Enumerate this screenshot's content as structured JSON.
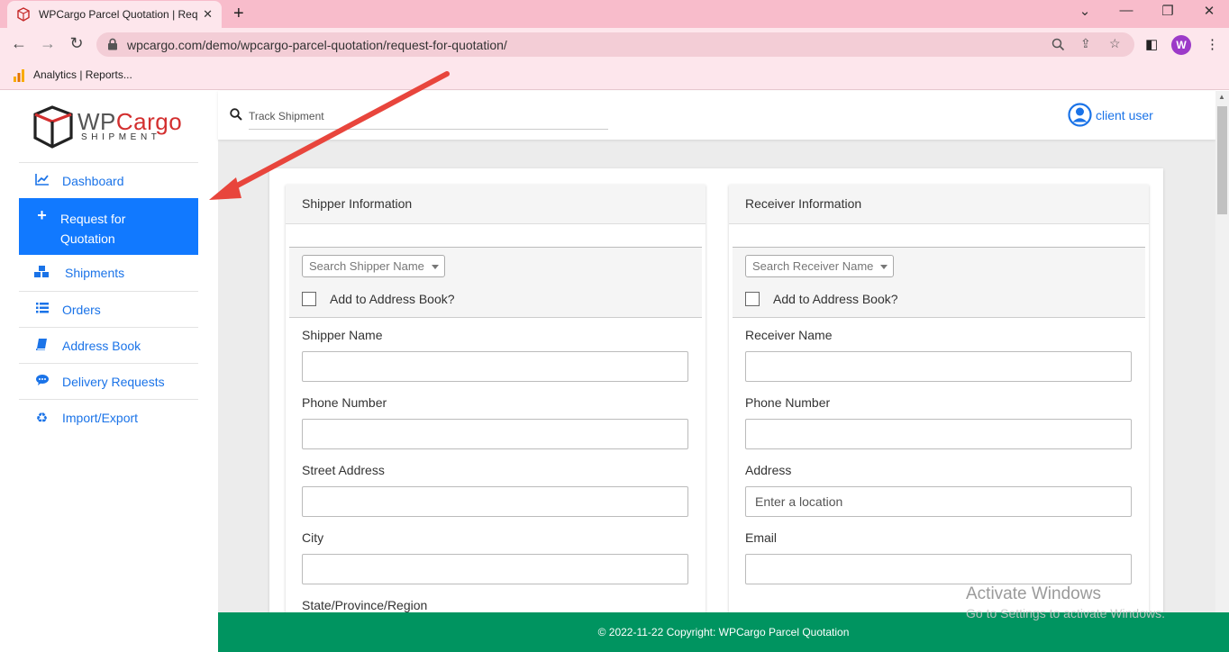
{
  "browser": {
    "tab_title": "WPCargo Parcel Quotation | Requ",
    "url": "wpcargo.com/demo/wpcargo-parcel-quotation/request-for-quotation/",
    "profile_initial": "W",
    "bookmark_label": "Analytics | Reports..."
  },
  "logo": {
    "wp": "WP",
    "cargo": "Cargo",
    "sub": "SHIPMENT"
  },
  "sidebar": {
    "items": [
      {
        "label": "Dashboard",
        "icon": "chart-line-icon"
      },
      {
        "label": "Request for Quotation",
        "icon": "plus-icon",
        "active": true
      },
      {
        "label": "Shipments",
        "icon": "cubes-icon"
      },
      {
        "label": "Orders",
        "icon": "list-icon"
      },
      {
        "label": "Address Book",
        "icon": "book-icon"
      },
      {
        "label": "Delivery Requests",
        "icon": "comment-icon"
      },
      {
        "label": "Import/Export",
        "icon": "recycle-icon"
      }
    ]
  },
  "topbar": {
    "track_placeholder": "Track Shipment",
    "user_label": "client user"
  },
  "shipper": {
    "title": "Shipper Information",
    "search_placeholder": "Search Shipper Name",
    "address_book_label": "Add to Address Book?",
    "fields": [
      {
        "label": "Shipper Name",
        "value": "",
        "placeholder": ""
      },
      {
        "label": "Phone Number",
        "value": "",
        "placeholder": ""
      },
      {
        "label": "Street Address",
        "value": "",
        "placeholder": ""
      },
      {
        "label": "City",
        "value": "",
        "placeholder": ""
      },
      {
        "label": "State/Province/Region"
      }
    ]
  },
  "receiver": {
    "title": "Receiver Information",
    "search_placeholder": "Search Receiver Name",
    "address_book_label": "Add to Address Book?",
    "fields": [
      {
        "label": "Receiver Name",
        "value": "",
        "placeholder": ""
      },
      {
        "label": "Phone Number",
        "value": "",
        "placeholder": ""
      },
      {
        "label": "Address",
        "value": "",
        "placeholder": "Enter a location"
      },
      {
        "label": "Email",
        "value": "",
        "placeholder": ""
      }
    ]
  },
  "footer": {
    "text": "© 2022-11-22 Copyright: ",
    "brand": "WPCargo Parcel Quotation"
  },
  "watermark": {
    "title": "Activate Windows",
    "subtitle": "Go to Settings to activate Windows."
  },
  "colors": {
    "accent": "#1179ff",
    "link": "#1a73e8",
    "footer": "#009460",
    "chrome": "#f8bccb",
    "annotation_arrow": "#e8453c"
  }
}
